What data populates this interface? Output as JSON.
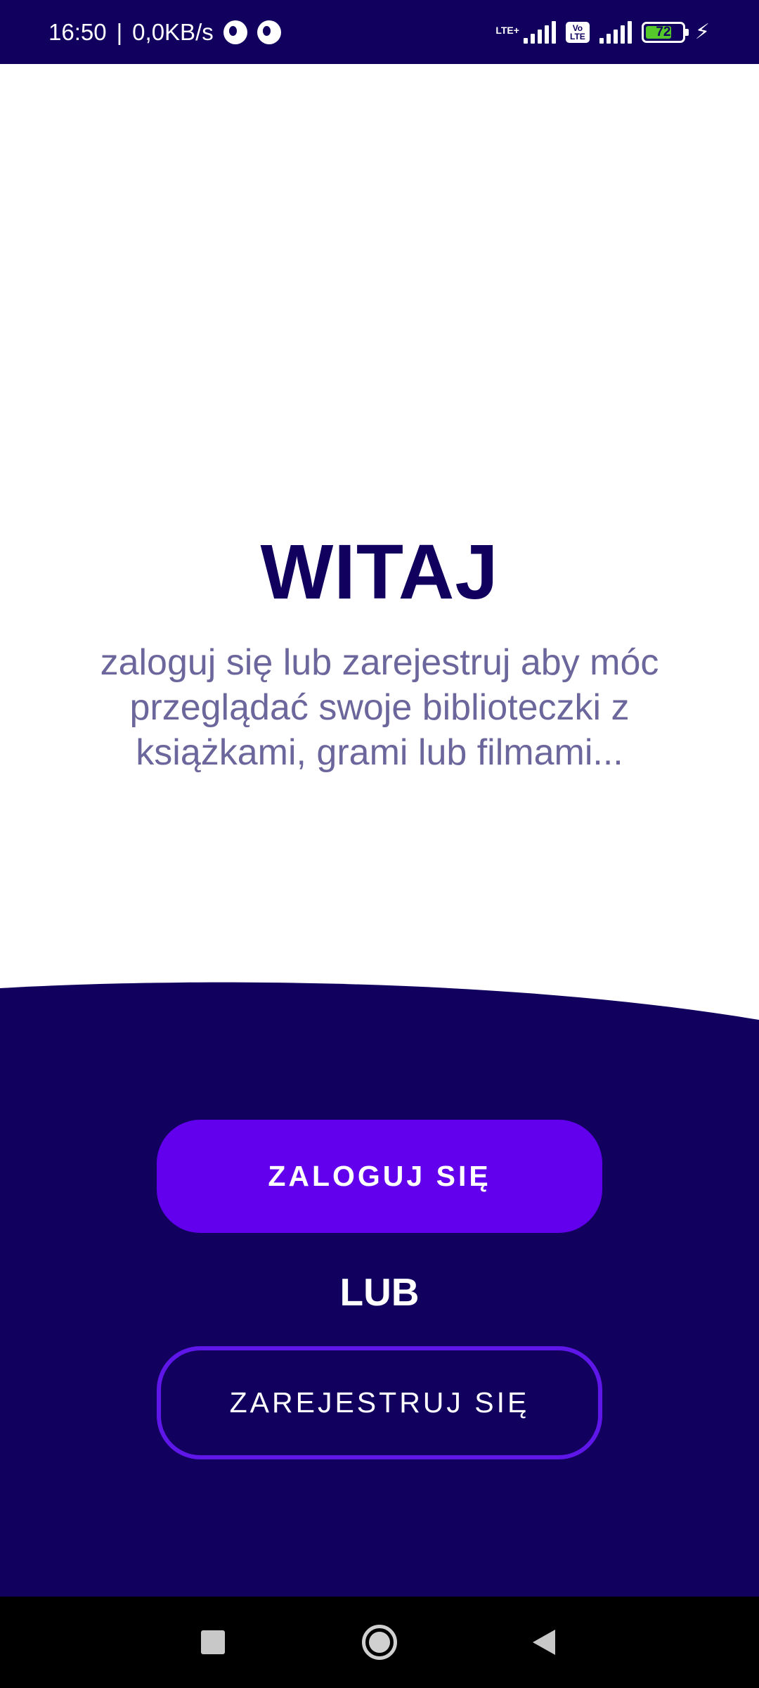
{
  "status_bar": {
    "time": "16:50",
    "separator": "|",
    "network_speed": "0,0KB/s",
    "network_type": "LTE+",
    "volte_top": "Vo",
    "volte_bottom": "LTE",
    "battery_level": "72",
    "battery_fraction": 0.72
  },
  "welcome": {
    "title": "WITAJ",
    "subtitle": "zaloguj się lub zarejestruj aby móc przeglądać swoje biblioteczki z książkami, grami lub filmami..."
  },
  "actions": {
    "login_label": "ZALOGUJ SIĘ",
    "or_label": "LUB",
    "register_label": "ZAREJESTRUJ SIĘ"
  },
  "colors": {
    "primary_dark": "#12005e",
    "accent": "#6200ee",
    "subtitle_text": "#6b669b",
    "battery_fill": "#55c92b"
  },
  "nav_bar": {
    "recents_icon": "recents-square-icon",
    "home_icon": "home-circle-icon",
    "back_icon": "back-triangle-icon"
  }
}
